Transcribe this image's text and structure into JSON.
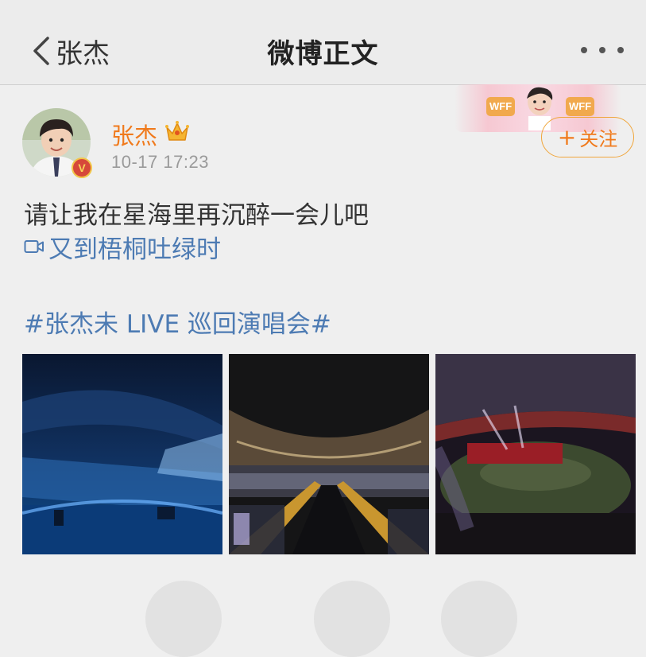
{
  "header": {
    "back_label": "张杰",
    "title": "微博正文"
  },
  "banner": {
    "badge_text": "WFF"
  },
  "post": {
    "author": "张杰",
    "verified_mark": "V",
    "timestamp": "10-17 17:23",
    "follow_label": "关注",
    "follow_plus": "+",
    "text": "请让我在星海里再沉醉一会儿吧",
    "location": "又到梧桐吐绿时",
    "hashtag": "#张杰未 LIVE 巡回演唱会#",
    "photos": [
      {
        "subject": "blue-lit stadium stage"
      },
      {
        "subject": "stadium crowd with light sticks"
      },
      {
        "subject": "stadium with red lights and stage"
      }
    ]
  },
  "icons": {
    "back": "chevron-left-icon",
    "more": "more-dots-icon",
    "crown": "crown-icon",
    "video": "video-camera-icon"
  },
  "colors": {
    "accent_orange": "#f07a1c",
    "link_blue": "#4d7bb3",
    "follow_border": "#f0a63c",
    "background": "#efefef"
  }
}
